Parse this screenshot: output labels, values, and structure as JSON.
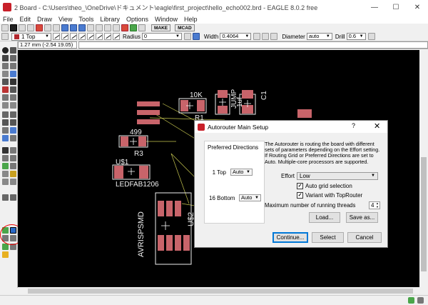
{
  "window": {
    "title": "2 Board - C:\\Users\\theo_\\OneDrive\\ドキュメント\\eagle\\first_project\\hello_echo002.brd - EAGLE 8.0.2 free",
    "controls": {
      "minimize": "—",
      "maximize": "☐",
      "close": "✕"
    }
  },
  "menu": [
    "File",
    "Edit",
    "Draw",
    "View",
    "Tools",
    "Library",
    "Options",
    "Window",
    "Help"
  ],
  "toolbar1": {
    "make_label": "MAKE",
    "mcad_label": "MCAD"
  },
  "toolbar2": {
    "layer": "1 Top",
    "radius_label": "Radius",
    "radius_value": "0",
    "width_label": "Width",
    "width_value": "0.4064",
    "diameter_label": "Diameter",
    "diameter_value": "auto",
    "drill_label": "Drill",
    "drill_value": "0.6"
  },
  "coordinates": "1.27 mm (-2.54 19.05)",
  "board": {
    "labels": [
      "10K",
      "R1",
      "1uf",
      "C1",
      "JUMP",
      "499",
      "R3",
      "U$1",
      "LEDFAB1206",
      "U$2",
      "AVRISPSMD"
    ],
    "colors": {
      "background": "#000000",
      "pad": "#c8646a",
      "outline": "#f0f0f0",
      "airwire": "#c8c850"
    }
  },
  "dialog": {
    "title": "Autorouter Main Setup",
    "help": "?",
    "close": "✕",
    "preferred_directions_heading": "Preferred Directions",
    "layers": [
      {
        "label": "1  Top",
        "direction": "Auto"
      },
      {
        "label": "16  Bottom",
        "direction": "Auto"
      }
    ],
    "description": "The Autorouter is routing the board with different sets of parameters depending on the Effort setting. If Routing Grid or Preferred Directions are set to Auto. Multiple-core processors are supported.",
    "effort_label": "Effort",
    "effort_value": "Low",
    "auto_grid_label": "Auto grid selection",
    "auto_grid_checked": true,
    "variant_label": "Variant with TopRouter",
    "variant_checked": true,
    "threads_label": "Maximum number of running threads",
    "threads_value": "4",
    "load_label": "Load...",
    "save_label": "Save as...",
    "continue_label": "Continue...",
    "select_label": "Select",
    "cancel_label": "Cancel"
  }
}
